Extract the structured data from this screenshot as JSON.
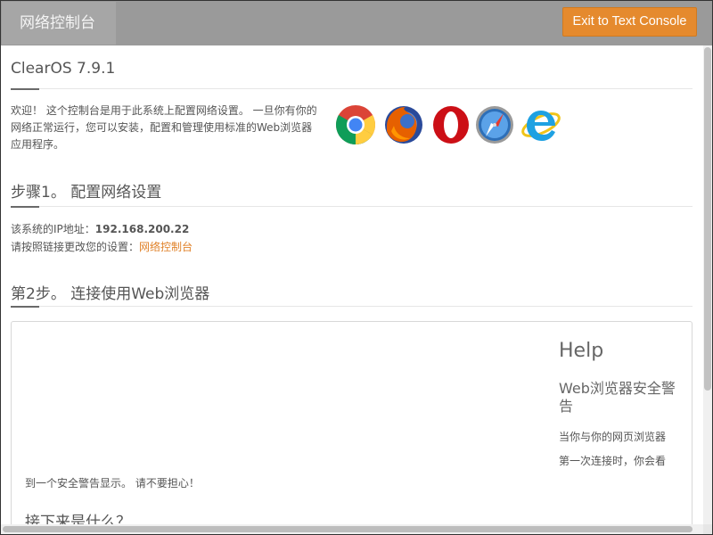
{
  "header": {
    "tab_label": "网络控制台",
    "exit_button_label": "Exit to Text Console",
    "accent_color": "#e58a2e"
  },
  "intro": {
    "title": "ClearOS 7.9.1",
    "welcome_text": "欢迎！ 这个控制台是用于此系统上配置网络设置。 一旦你有你的网络正常运行，您可以安装，配置和管理使用标准的Web浏览器应用程序。",
    "browser_icons": [
      "chrome-icon",
      "firefox-icon",
      "opera-icon",
      "safari-icon",
      "internet-explorer-icon"
    ]
  },
  "step1": {
    "title": "步骤1。 配置网络设置",
    "ip_label": "该系统的IP地址：",
    "ip_value": "192.168.200.22",
    "link_prompt": "请按照链接更改您的设置：",
    "link_text": "网络控制台"
  },
  "step2": {
    "title": "第2步。 连接使用Web浏览器"
  },
  "help": {
    "title": "Help",
    "subtitle": "Web浏览器安全警告",
    "body_line1": "当你与你的网页浏览器",
    "body_line2": "第一次连接时，你会看",
    "body_line3": "到一个安全警告显示。 请不要担心！",
    "next_heading": "接下来是什么？"
  }
}
